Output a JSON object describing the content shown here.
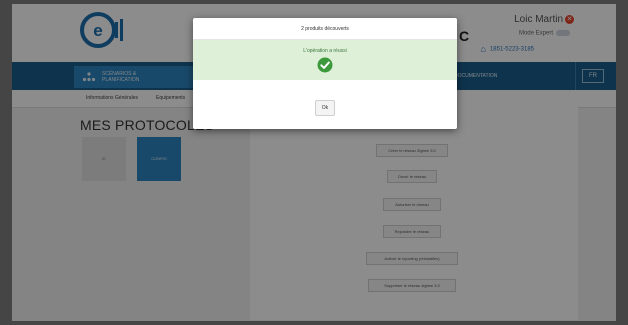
{
  "header": {
    "logo_icon": "eh-logo-icon",
    "user_name": "Loic Martin",
    "logout_icon": "close-icon",
    "expert_mode_label": "Mode Expert",
    "phone": "1851-5223-3185",
    "home_icon": "home-icon",
    "partial_logo_text": "C"
  },
  "nav": {
    "active_item": "SCÉNARIOS & PLANIFICATION",
    "right_item": "DOCUMENTATION",
    "right_icon_text": "FR"
  },
  "subnav": {
    "tabs": [
      "Informations Générales",
      "Equipements"
    ]
  },
  "main": {
    "title": "MES PROTOCOLES",
    "cards": [
      "IE",
      "CONFIG"
    ]
  },
  "panel": {
    "buttons": [
      "Créer le réseau Zigbee 3.0",
      "Ouvrir le réseau",
      "Autoriser le réseau",
      "Rejoindre le réseau",
      "Activer le reporting (réinstallés)",
      "Supprimer le réseau zigbee 3.0"
    ]
  },
  "modal": {
    "title": "2 produits découverts",
    "message": "L'opération a réussi",
    "status_icon": "check-circle-icon",
    "ok_label": "Ok",
    "colors": {
      "success_bg": "#dff0d8",
      "success_icon": "#3c9a3c"
    }
  },
  "colors": {
    "nav_bg": "#1a5f8c",
    "accent": "#2e86c1"
  }
}
